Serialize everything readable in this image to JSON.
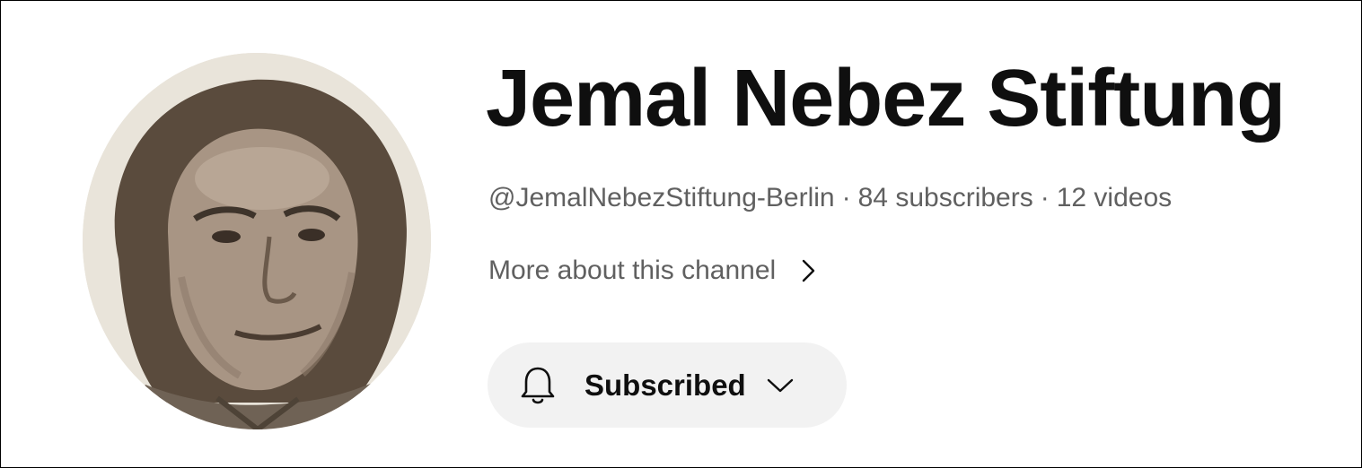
{
  "channel": {
    "name": "Jemal Nebez Stiftung",
    "handle": "@JemalNebezStiftung-Berlin",
    "separator": "·",
    "subscribers": "84 subscribers",
    "videos": "12 videos",
    "more_about": "More about this channel"
  },
  "subscribe_button": {
    "label": "Subscribed",
    "icon": "bell-icon",
    "dropdown_icon": "chevron-down-icon"
  },
  "avatar": {
    "icon": "channel-avatar"
  },
  "colors": {
    "title": "#0f0f0f",
    "secondary_text": "#606060",
    "button_bg": "#f2f2f2"
  }
}
